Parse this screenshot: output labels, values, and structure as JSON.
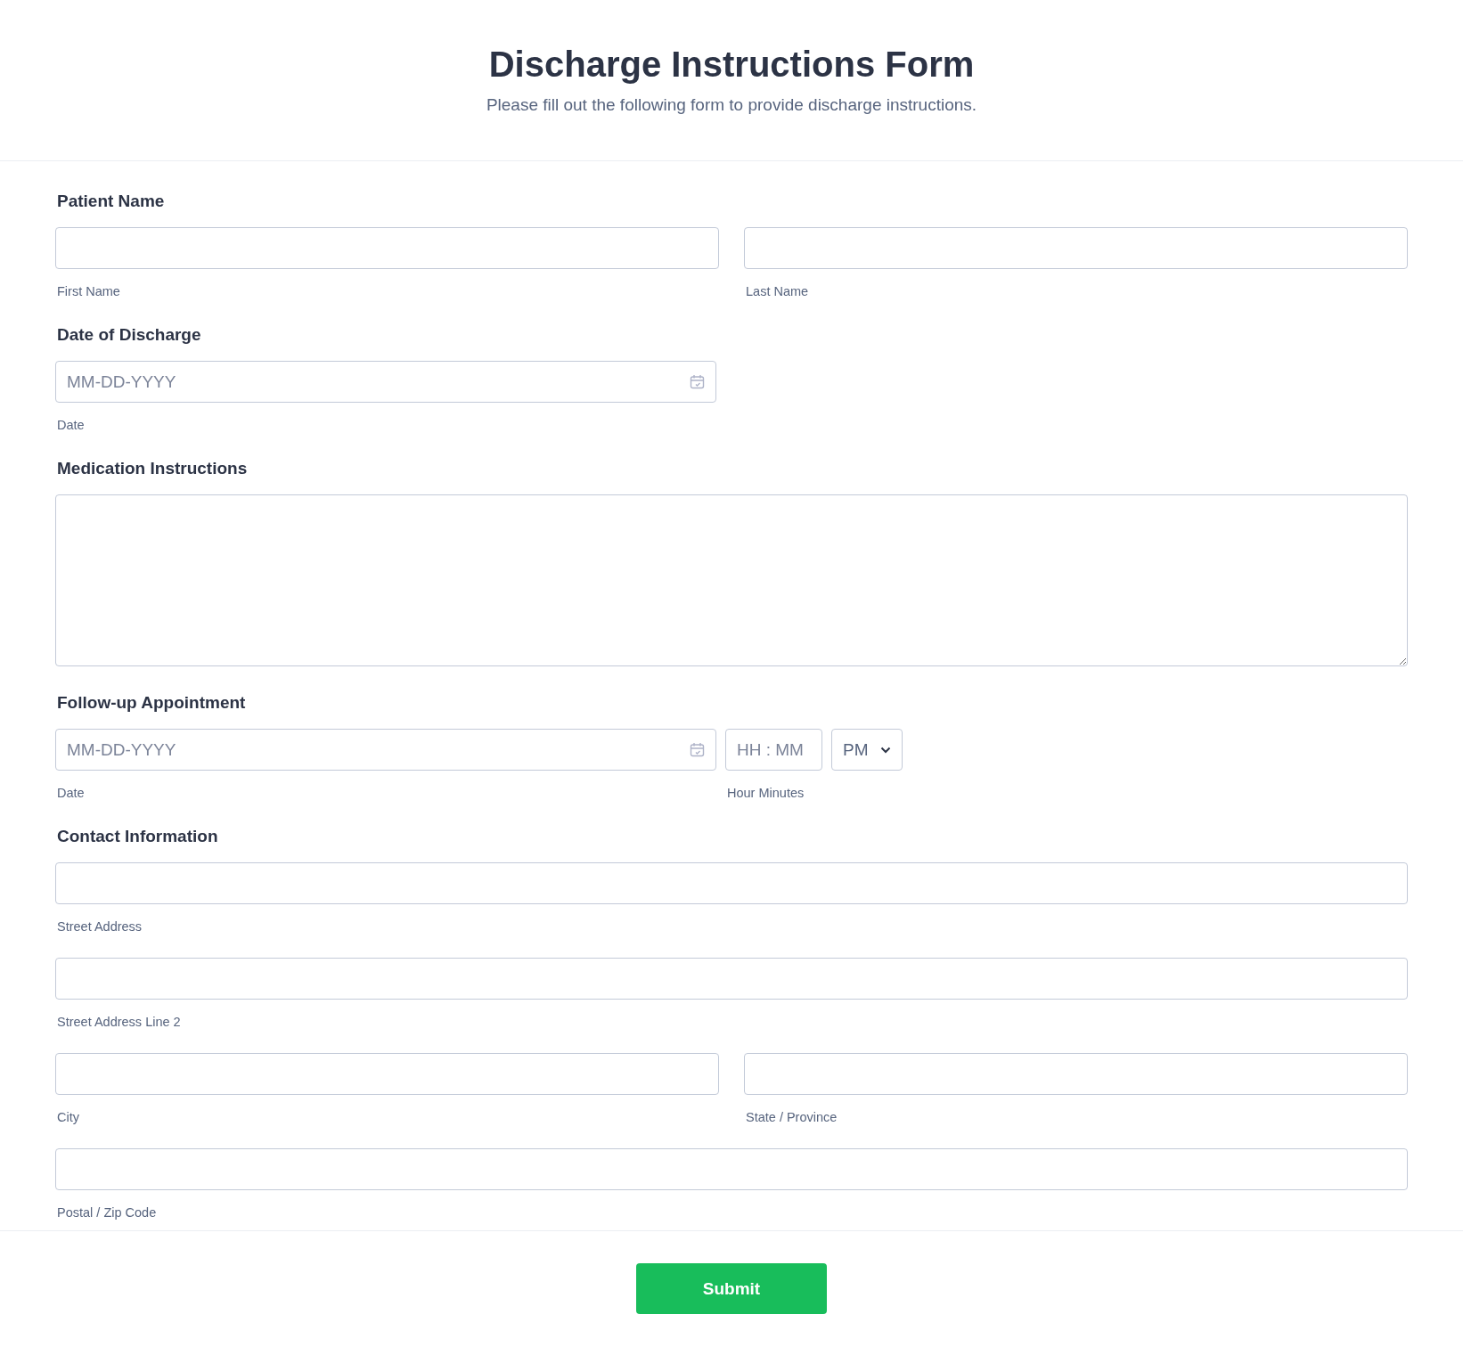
{
  "header": {
    "title": "Discharge Instructions Form",
    "subtitle": "Please fill out the following form to provide discharge instructions."
  },
  "sections": [
    {
      "label": "Patient Name",
      "rows": [
        [
          {
            "kind": "text",
            "sublabel": "First Name"
          },
          {
            "kind": "text",
            "sublabel": "Last Name"
          }
        ]
      ]
    },
    {
      "label": "Date of Discharge",
      "rows": [
        [
          {
            "kind": "date",
            "placeholder": "MM-DD-YYYY",
            "sublabel": "Date"
          }
        ]
      ]
    },
    {
      "label": "Medication Instructions",
      "rows": [
        [
          {
            "kind": "textarea"
          }
        ]
      ]
    },
    {
      "label": "Follow-up Appointment",
      "rows": [
        [
          {
            "kind": "date",
            "placeholder": "MM-DD-YYYY",
            "sublabel": "Date"
          },
          {
            "kind": "time",
            "placeholder": "HH : MM",
            "sublabel": "Hour Minutes"
          },
          {
            "kind": "select",
            "value": "PM"
          }
        ]
      ]
    },
    {
      "label": "Contact Information",
      "rows": [
        [
          {
            "kind": "text",
            "sublabel": "Street Address"
          }
        ],
        [
          {
            "kind": "text",
            "sublabel": "Street Address Line 2"
          }
        ],
        [
          {
            "kind": "text",
            "sublabel": "City"
          },
          {
            "kind": "text",
            "sublabel": "State / Province"
          }
        ],
        [
          {
            "kind": "text",
            "sublabel": "Postal / Zip Code"
          }
        ]
      ]
    }
  ],
  "submit": "Submit"
}
